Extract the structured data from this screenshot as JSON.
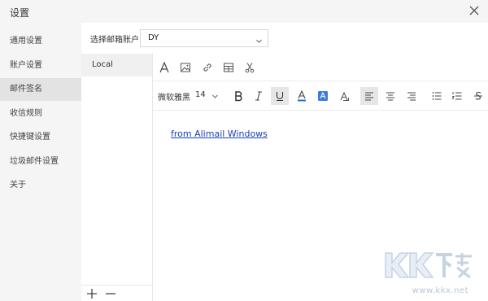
{
  "window": {
    "title": "设置",
    "close_icon": "close-icon"
  },
  "sidebar": {
    "items": [
      {
        "label": "通用设置",
        "active": false
      },
      {
        "label": "账户设置",
        "active": false
      },
      {
        "label": "邮件签名",
        "active": true
      },
      {
        "label": "收信规则",
        "active": false
      },
      {
        "label": "快捷键设置",
        "active": false
      },
      {
        "label": "垃圾邮件设置",
        "active": false
      },
      {
        "label": "关于",
        "active": false
      }
    ]
  },
  "account": {
    "label": "选择邮箱账户",
    "selected": "DY"
  },
  "signatures": {
    "items": [
      {
        "name": "Local",
        "selected": true
      }
    ],
    "add_icon": "plus-icon",
    "remove_icon": "minus-icon"
  },
  "toolbar": {
    "insert_tools": [
      "font-style-icon",
      "image-icon",
      "link-icon",
      "table-icon",
      "cut-icon"
    ],
    "font_name": "微软雅黑",
    "font_size": "14",
    "format_tools": [
      "bold-icon",
      "italic-icon",
      "underline-icon",
      "font-color-icon",
      "highlight-icon",
      "clear-format-icon",
      "align-left-icon",
      "align-center-icon",
      "align-right-icon",
      "bullet-list-icon",
      "numbered-list-icon",
      "strikethrough-icon"
    ],
    "accent_color": "#2b6ad9"
  },
  "editor": {
    "signature_text": "from Alimail Windows"
  },
  "watermark": {
    "logo_text": "KK下载",
    "url": "www.kkx.net"
  }
}
